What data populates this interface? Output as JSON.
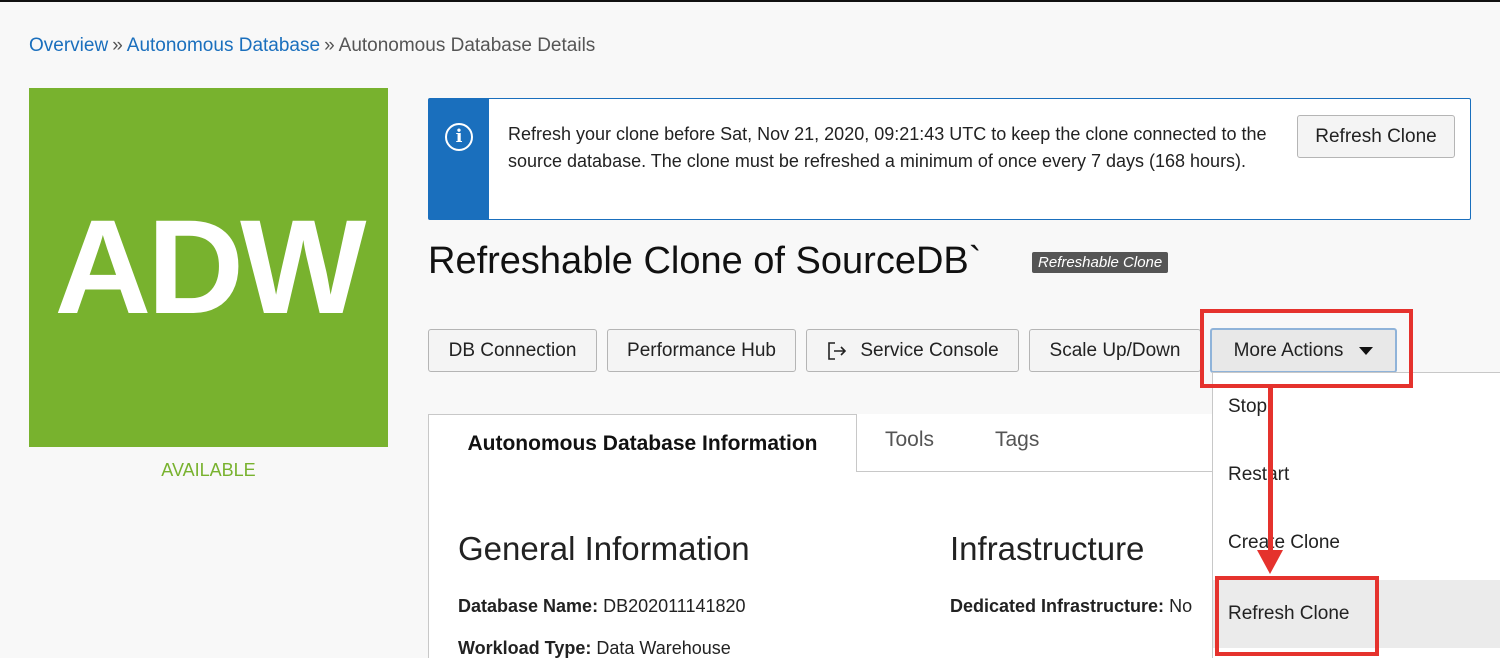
{
  "breadcrumb": {
    "items": [
      "Overview",
      "Autonomous Database",
      "Autonomous Database Details"
    ],
    "separator": "»"
  },
  "tile": {
    "label": "ADW",
    "status": "AVAILABLE",
    "color": "#78b22e"
  },
  "banner": {
    "icon": "info-icon",
    "message": "Refresh your clone before Sat, Nov 21, 2020, 09:21:43 UTC to keep the clone connected to the source database. The clone must be refreshed a minimum of once every 7 days (168 hours).",
    "button_label": "Refresh Clone",
    "accent": "#1a6fbd"
  },
  "page": {
    "title": "Refreshable Clone of SourceDB`",
    "badge": "Refreshable Clone"
  },
  "actions": {
    "db_connection": "DB Connection",
    "performance_hub": "Performance Hub",
    "service_console": "Service Console",
    "scale": "Scale Up/Down",
    "more_actions": "More Actions"
  },
  "dropdown": {
    "items": [
      "Stop",
      "Restart",
      "Create Clone",
      "Refresh Clone"
    ],
    "highlighted": "Refresh Clone"
  },
  "tabs": {
    "items": [
      "Autonomous Database Information",
      "Tools",
      "Tags"
    ],
    "active": "Autonomous Database Information"
  },
  "general": {
    "title": "General Information",
    "db_name_label": "Database Name:",
    "db_name_value": "DB202011141820",
    "workload_label": "Workload Type:",
    "workload_value": "Data Warehouse"
  },
  "infrastructure": {
    "title": "Infrastructure",
    "dedicated_label": "Dedicated Infrastructure:",
    "dedicated_value": "No"
  },
  "annotation_color": "#e5322d"
}
